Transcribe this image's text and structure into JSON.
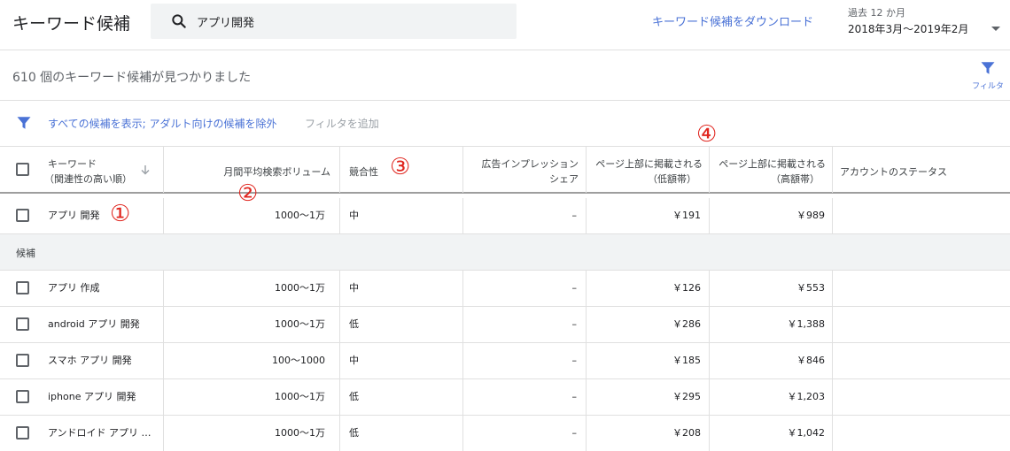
{
  "header": {
    "title": "キーワード候補",
    "search_value": "アプリ開発",
    "download_link": "キーワード候補をダウンロード",
    "date_range_label": "過去 12 か月",
    "date_range_value": "2018年3月〜2019年2月"
  },
  "summary": {
    "count_text": "610 個のキーワード候補が見つかりました",
    "filter_button_label": "フィルタ"
  },
  "filters": {
    "applied": "すべての候補を表示; アダルト向けの候補を除外",
    "add_filter": "フィルタを追加"
  },
  "annotations": [
    "①",
    "②",
    "③",
    "④"
  ],
  "table": {
    "columns": {
      "keyword_line1": "キーワード",
      "keyword_line2": "（関連性の高い順）",
      "volume": "月間平均検索ボリューム",
      "competition": "競合性",
      "impression_line1": "広告インプレッション",
      "impression_line2": "シェア",
      "low_bid_line1": "ページ上部に掲載される",
      "low_bid_line2": "（低額帯）",
      "high_bid_line1": "ページ上部に掲載される",
      "high_bid_line2": "（高額帯）",
      "status": "アカウントのステータス"
    },
    "searched_row": {
      "keyword": "アプリ 開発",
      "volume": "1000〜1万",
      "competition": "中",
      "impression": "–",
      "low_bid": "￥191",
      "high_bid": "￥989"
    },
    "section_label": "候補",
    "rows": [
      {
        "keyword": "アプリ 作成",
        "volume": "1000〜1万",
        "competition": "中",
        "impression": "–",
        "low_bid": "￥126",
        "high_bid": "￥553"
      },
      {
        "keyword": "android アプリ 開発",
        "volume": "1000〜1万",
        "competition": "低",
        "impression": "–",
        "low_bid": "￥286",
        "high_bid": "￥1,388"
      },
      {
        "keyword": "スマホ アプリ 開発",
        "volume": "100〜1000",
        "competition": "中",
        "impression": "–",
        "low_bid": "￥185",
        "high_bid": "￥846"
      },
      {
        "keyword": "iphone アプリ 開発",
        "volume": "1000〜1万",
        "competition": "低",
        "impression": "–",
        "low_bid": "￥295",
        "high_bid": "￥1,203"
      },
      {
        "keyword": "アンドロイド アプリ …",
        "volume": "1000〜1万",
        "competition": "低",
        "impression": "–",
        "low_bid": "￥208",
        "high_bid": "￥1,042"
      }
    ]
  },
  "colors": {
    "accent": "#4a72d6",
    "annotation": "#e0261f"
  }
}
